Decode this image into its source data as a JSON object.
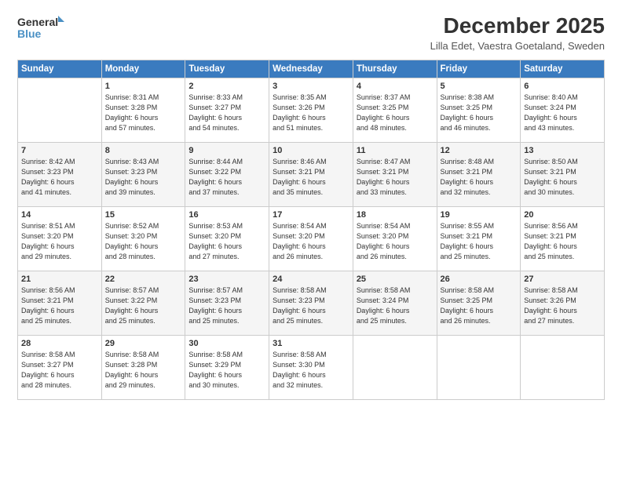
{
  "logo": {
    "line1": "General",
    "line2": "Blue"
  },
  "title": "December 2025",
  "subtitle": "Lilla Edet, Vaestra Goetaland, Sweden",
  "days_header": [
    "Sunday",
    "Monday",
    "Tuesday",
    "Wednesday",
    "Thursday",
    "Friday",
    "Saturday"
  ],
  "weeks": [
    [
      {
        "num": "",
        "info": ""
      },
      {
        "num": "1",
        "info": "Sunrise: 8:31 AM\nSunset: 3:28 PM\nDaylight: 6 hours\nand 57 minutes."
      },
      {
        "num": "2",
        "info": "Sunrise: 8:33 AM\nSunset: 3:27 PM\nDaylight: 6 hours\nand 54 minutes."
      },
      {
        "num": "3",
        "info": "Sunrise: 8:35 AM\nSunset: 3:26 PM\nDaylight: 6 hours\nand 51 minutes."
      },
      {
        "num": "4",
        "info": "Sunrise: 8:37 AM\nSunset: 3:25 PM\nDaylight: 6 hours\nand 48 minutes."
      },
      {
        "num": "5",
        "info": "Sunrise: 8:38 AM\nSunset: 3:25 PM\nDaylight: 6 hours\nand 46 minutes."
      },
      {
        "num": "6",
        "info": "Sunrise: 8:40 AM\nSunset: 3:24 PM\nDaylight: 6 hours\nand 43 minutes."
      }
    ],
    [
      {
        "num": "7",
        "info": "Sunrise: 8:42 AM\nSunset: 3:23 PM\nDaylight: 6 hours\nand 41 minutes."
      },
      {
        "num": "8",
        "info": "Sunrise: 8:43 AM\nSunset: 3:23 PM\nDaylight: 6 hours\nand 39 minutes."
      },
      {
        "num": "9",
        "info": "Sunrise: 8:44 AM\nSunset: 3:22 PM\nDaylight: 6 hours\nand 37 minutes."
      },
      {
        "num": "10",
        "info": "Sunrise: 8:46 AM\nSunset: 3:21 PM\nDaylight: 6 hours\nand 35 minutes."
      },
      {
        "num": "11",
        "info": "Sunrise: 8:47 AM\nSunset: 3:21 PM\nDaylight: 6 hours\nand 33 minutes."
      },
      {
        "num": "12",
        "info": "Sunrise: 8:48 AM\nSunset: 3:21 PM\nDaylight: 6 hours\nand 32 minutes."
      },
      {
        "num": "13",
        "info": "Sunrise: 8:50 AM\nSunset: 3:21 PM\nDaylight: 6 hours\nand 30 minutes."
      }
    ],
    [
      {
        "num": "14",
        "info": "Sunrise: 8:51 AM\nSunset: 3:20 PM\nDaylight: 6 hours\nand 29 minutes."
      },
      {
        "num": "15",
        "info": "Sunrise: 8:52 AM\nSunset: 3:20 PM\nDaylight: 6 hours\nand 28 minutes."
      },
      {
        "num": "16",
        "info": "Sunrise: 8:53 AM\nSunset: 3:20 PM\nDaylight: 6 hours\nand 27 minutes."
      },
      {
        "num": "17",
        "info": "Sunrise: 8:54 AM\nSunset: 3:20 PM\nDaylight: 6 hours\nand 26 minutes."
      },
      {
        "num": "18",
        "info": "Sunrise: 8:54 AM\nSunset: 3:20 PM\nDaylight: 6 hours\nand 26 minutes."
      },
      {
        "num": "19",
        "info": "Sunrise: 8:55 AM\nSunset: 3:21 PM\nDaylight: 6 hours\nand 25 minutes."
      },
      {
        "num": "20",
        "info": "Sunrise: 8:56 AM\nSunset: 3:21 PM\nDaylight: 6 hours\nand 25 minutes."
      }
    ],
    [
      {
        "num": "21",
        "info": "Sunrise: 8:56 AM\nSunset: 3:21 PM\nDaylight: 6 hours\nand 25 minutes."
      },
      {
        "num": "22",
        "info": "Sunrise: 8:57 AM\nSunset: 3:22 PM\nDaylight: 6 hours\nand 25 minutes."
      },
      {
        "num": "23",
        "info": "Sunrise: 8:57 AM\nSunset: 3:23 PM\nDaylight: 6 hours\nand 25 minutes."
      },
      {
        "num": "24",
        "info": "Sunrise: 8:58 AM\nSunset: 3:23 PM\nDaylight: 6 hours\nand 25 minutes."
      },
      {
        "num": "25",
        "info": "Sunrise: 8:58 AM\nSunset: 3:24 PM\nDaylight: 6 hours\nand 25 minutes."
      },
      {
        "num": "26",
        "info": "Sunrise: 8:58 AM\nSunset: 3:25 PM\nDaylight: 6 hours\nand 26 minutes."
      },
      {
        "num": "27",
        "info": "Sunrise: 8:58 AM\nSunset: 3:26 PM\nDaylight: 6 hours\nand 27 minutes."
      }
    ],
    [
      {
        "num": "28",
        "info": "Sunrise: 8:58 AM\nSunset: 3:27 PM\nDaylight: 6 hours\nand 28 minutes."
      },
      {
        "num": "29",
        "info": "Sunrise: 8:58 AM\nSunset: 3:28 PM\nDaylight: 6 hours\nand 29 minutes."
      },
      {
        "num": "30",
        "info": "Sunrise: 8:58 AM\nSunset: 3:29 PM\nDaylight: 6 hours\nand 30 minutes."
      },
      {
        "num": "31",
        "info": "Sunrise: 8:58 AM\nSunset: 3:30 PM\nDaylight: 6 hours\nand 32 minutes."
      },
      {
        "num": "",
        "info": ""
      },
      {
        "num": "",
        "info": ""
      },
      {
        "num": "",
        "info": ""
      }
    ]
  ]
}
